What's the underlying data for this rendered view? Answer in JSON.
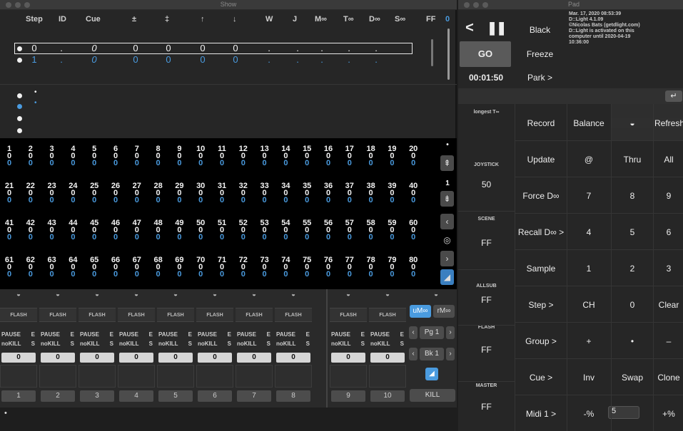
{
  "show": {
    "title": "Show",
    "headers": [
      "Step",
      "ID",
      "Cue",
      "±",
      "‡",
      "↑",
      "↓",
      "W",
      "J",
      "M∞",
      "T∞",
      "D∞",
      "S∞",
      "FF",
      "0"
    ],
    "cue_row1": {
      "step": "0",
      "id": ".",
      "cue": "0",
      "a": "0",
      "b": "0",
      "c": "0",
      "d": "0",
      "dots": [
        ".",
        ".",
        ".",
        ".",
        "."
      ]
    },
    "cue_row2": {
      "step": "1",
      "id": ".",
      "cue": "0",
      "a": "0",
      "b": "0",
      "c": "0",
      "d": "0",
      "dots": [
        ".",
        ".",
        ".",
        ".",
        "."
      ]
    },
    "channel_values_top": "0",
    "channel_values_bottom": "0",
    "side_labels": {
      "top": "•",
      "one": "1"
    },
    "faders": {
      "flash_label": "FLASH",
      "pause_label": "PAUSE",
      "e_label": "E",
      "nokill_label": "noKILL",
      "s_label": "S",
      "value": "0",
      "numbers": [
        "1",
        "2",
        "3",
        "4",
        "5",
        "6",
        "7",
        "8",
        "9",
        "10"
      ],
      "umoo": "uM∞",
      "rmoo": "rM∞",
      "page": "Pg 1",
      "bank": "Bk 1",
      "kill": "KILL",
      "bottom_dot": "•"
    }
  },
  "pad": {
    "title": "Pad",
    "info_lines": [
      "Mar. 17, 2020 08:53:39",
      "D::Light 4.1.09",
      "©Nicolas Bats (getdlight.com)",
      "D::Light is activated on this",
      "computer until 2020-04-19",
      "10:36:00"
    ],
    "top_buttons": {
      "black": "Black",
      "freeze": "Freeze",
      "park": "Park >",
      "go": "GO",
      "time": "00:01:50"
    },
    "enter_icon": "↵",
    "side": [
      {
        "label": "longest T∞",
        "value": ""
      },
      {
        "label": "JOYSTICK",
        "value": "50"
      },
      {
        "label": "SCENE",
        "value": "FF"
      },
      {
        "label": "ALLSUB",
        "value": "FF"
      },
      {
        "label": "FLASH",
        "value": "FF"
      },
      {
        "label": "MASTER",
        "value": "FF"
      }
    ],
    "grid": [
      [
        "Record",
        "Balance",
        "◒",
        "Refresh"
      ],
      [
        "Update",
        "@",
        "Thru",
        "All"
      ],
      [
        "Force D∞",
        "7",
        "8",
        "9"
      ],
      [
        "Recall D∞ >",
        "4",
        "5",
        "6"
      ],
      [
        "Sample",
        "1",
        "2",
        "3"
      ],
      [
        "Step >",
        "CH",
        "0",
        "Clear"
      ],
      [
        "Group >",
        "+",
        "•",
        "–"
      ],
      [
        "Cue >",
        "Inv",
        "Swap",
        "Clone"
      ],
      [
        "Midi 1 >",
        "-%",
        "5",
        "+%"
      ]
    ]
  },
  "colors": {
    "accent": "#4a9bdf",
    "bg": "#262626"
  }
}
